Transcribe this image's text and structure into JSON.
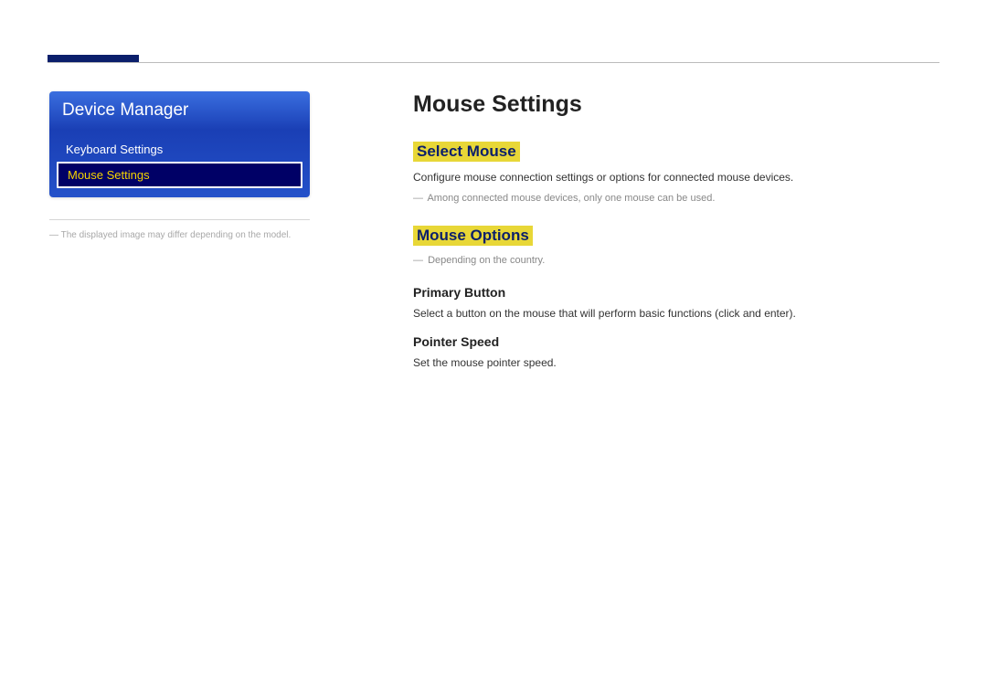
{
  "sidebar": {
    "title": "Device Manager",
    "items": [
      {
        "label": "Keyboard Settings",
        "active": false
      },
      {
        "label": "Mouse Settings",
        "active": true
      }
    ],
    "note": "The displayed image may differ depending on the model."
  },
  "main": {
    "title": "Mouse Settings",
    "sections": {
      "selectMouse": {
        "heading": "Select Mouse",
        "text": "Configure mouse connection settings or options for connected mouse devices.",
        "note": "Among connected mouse devices, only one mouse can be used."
      },
      "mouseOptions": {
        "heading": "Mouse Options",
        "note": "Depending on the country.",
        "primaryButton": {
          "heading": "Primary Button",
          "text": "Select a button on the mouse that will perform basic functions (click and enter)."
        },
        "pointerSpeed": {
          "heading": "Pointer Speed",
          "text": "Set the mouse pointer speed."
        }
      }
    }
  }
}
